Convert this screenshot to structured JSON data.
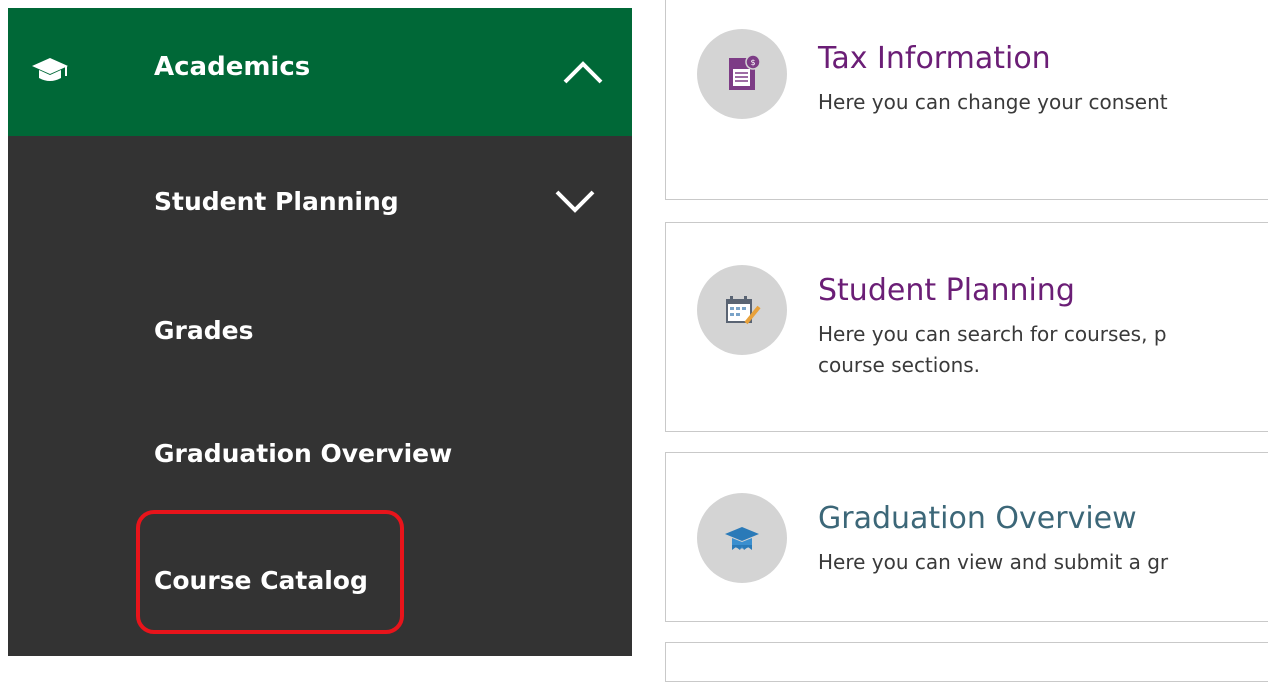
{
  "sidebar": {
    "section": {
      "label": "Academics",
      "icon": "graduation-cap-icon",
      "state_icon": "chevron-up-icon"
    },
    "items": [
      {
        "label": "Student Planning",
        "state_icon": "chevron-down-icon"
      },
      {
        "label": "Grades"
      },
      {
        "label": "Graduation Overview"
      },
      {
        "label": "Course Catalog",
        "highlighted": true
      }
    ],
    "colors": {
      "section_bg": "#006837",
      "menu_bg": "#333333",
      "highlight": "#e8141b"
    }
  },
  "cards": [
    {
      "title": "Tax Information",
      "description": "Here you can change your consent",
      "icon": "tax-document-icon"
    },
    {
      "title": "Student Planning",
      "description_lines": [
        "Here you can search for courses, p",
        "course sections."
      ],
      "icon": "calendar-icon"
    },
    {
      "title": "Graduation Overview",
      "description": "Here you can view and submit a gr",
      "icon": "graduation-cap-icon"
    }
  ]
}
